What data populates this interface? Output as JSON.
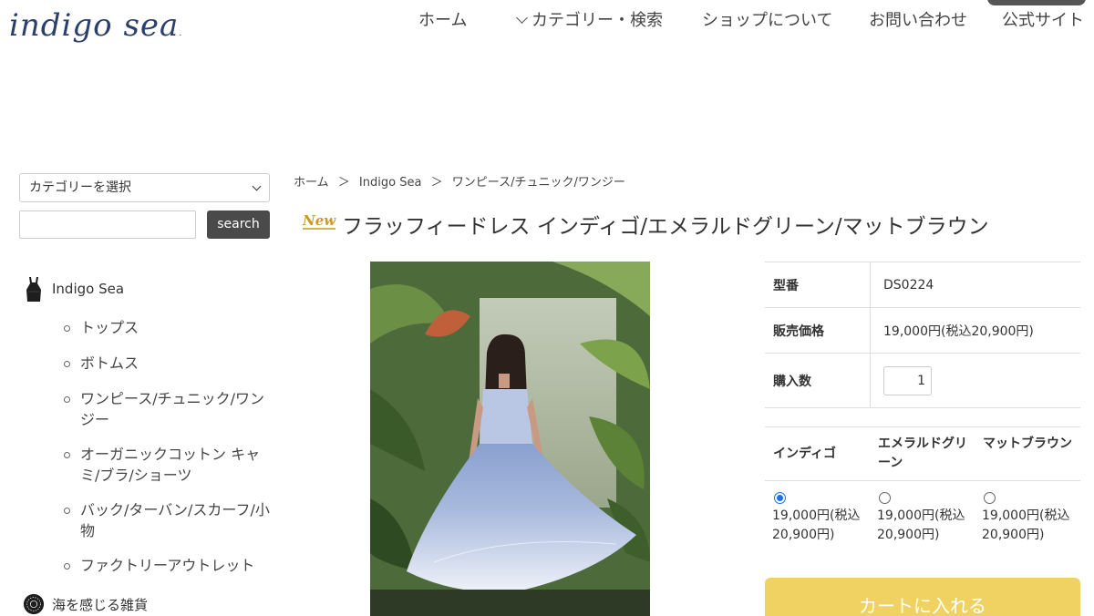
{
  "header": {
    "logo_text": "indigo sea",
    "nav": [
      {
        "label": "ホーム"
      },
      {
        "label": "カテゴリー・検索"
      },
      {
        "label": "ショップについて"
      },
      {
        "label": "お問い合わせ"
      },
      {
        "label": "公式サイト"
      }
    ]
  },
  "sidebar": {
    "category_select": "カテゴリーを選択",
    "search_value": "",
    "search_button": "search",
    "brand1": {
      "label": "Indigo Sea",
      "icon": "tank-top-icon"
    },
    "brand1_items": [
      {
        "label": "トップス"
      },
      {
        "label": "ボトムス"
      },
      {
        "label": "ワンピース/チュニック/ワンジー"
      },
      {
        "label": "オーガニックコットン キャミ/ブラ/ショーツ"
      },
      {
        "label": "バック/ターバン/スカーフ/小物"
      },
      {
        "label": "ファクトリーアウトレット"
      }
    ],
    "brand2": {
      "label": "海を感じる雑貨",
      "icon": "shell-icon"
    }
  },
  "breadcrumb": [
    {
      "label": "ホーム"
    },
    {
      "label": "＞"
    },
    {
      "label": "Indigo Sea"
    },
    {
      "label": "＞"
    },
    {
      "label": "ワンピース/チュニック/ワンジー"
    }
  ],
  "product": {
    "badge": "New",
    "title": "フラッフィードレス インディゴ/エメラルドグリーン/マットブラウン",
    "specs": [
      {
        "key": "型番",
        "value": "DS0224"
      },
      {
        "key": "販売価格",
        "value": "19,000円(税込20,900円)"
      },
      {
        "key": "購入数",
        "value": "1"
      }
    ],
    "options": [
      {
        "name": "インディゴ",
        "price": "19,000円(税込20,900円)",
        "selected": true
      },
      {
        "name": "エメラルドグリーン",
        "price": "19,000円(税込20,900円)",
        "selected": false
      },
      {
        "name": "マットブラウン",
        "price": "19,000円(税込20,900円)",
        "selected": false
      }
    ],
    "cart_button": "カートに入れる"
  },
  "colors": {
    "accent": "#f0d263",
    "link": "#2b3f6e",
    "button_dark": "#4a4a4a"
  }
}
